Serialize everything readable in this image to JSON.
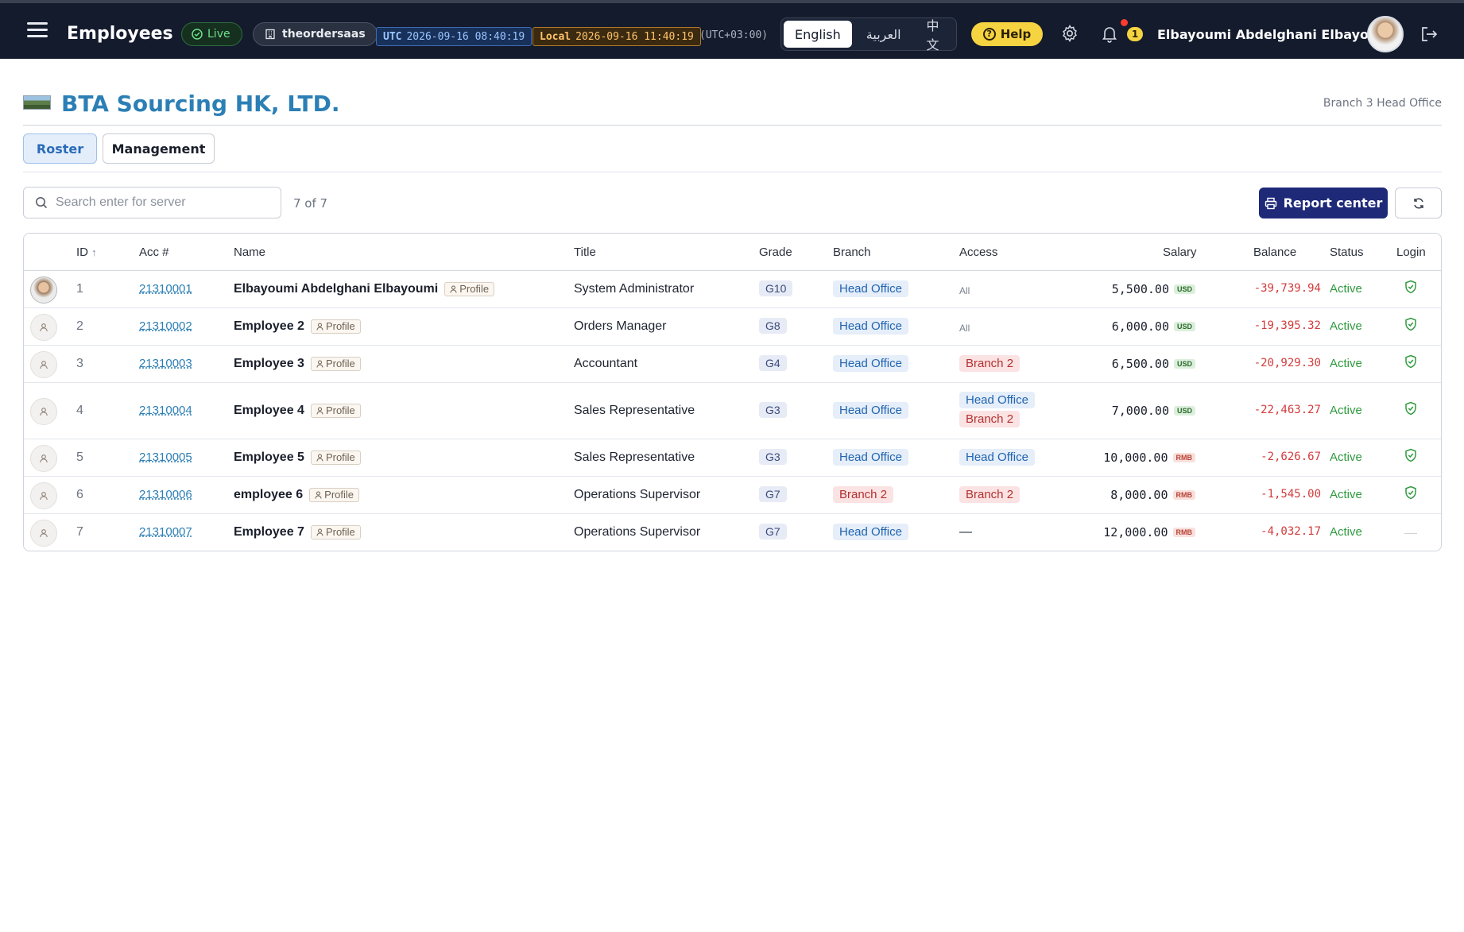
{
  "topbar": {
    "title": "Employees",
    "live": "Live",
    "tenant": "theordersaas",
    "utc_label": "UTC",
    "utc_time": "2026-09-16 08:40:19",
    "local_label": "Local",
    "local_time": "2026-09-16 11:40:19",
    "tz": "(UTC+03:00)",
    "languages": [
      "English",
      "العربية",
      "中文"
    ],
    "help": "Help",
    "notif_count": "1",
    "user": "Elbayoumi Abdelghani Elbayoumi"
  },
  "header": {
    "company": "BTA Sourcing HK, LTD.",
    "branch": "Branch 3 Head Office"
  },
  "tabs": [
    "Roster",
    "Management"
  ],
  "toolbar": {
    "search_placeholder": "Search enter for server",
    "count": "7 of 7",
    "report_label": "Report center"
  },
  "table": {
    "columns": [
      "ID",
      "Acc #",
      "Name",
      "Title",
      "Grade",
      "Branch",
      "Access",
      "Salary",
      "Balance",
      "Status",
      "Login"
    ],
    "profile_label": "Profile",
    "rows": [
      {
        "id": "1",
        "acc": "21310001",
        "name": "Elbayoumi Abdelghani Elbayoumi",
        "title": "System Administrator",
        "grade": "G10",
        "branch": "Head Office",
        "access": [
          "All"
        ],
        "salary": "5,500.00",
        "currency": "USD",
        "balance": "-39,739.94",
        "status": "Active",
        "login": true
      },
      {
        "id": "2",
        "acc": "21310002",
        "name": "Employee 2",
        "title": "Orders Manager",
        "grade": "G8",
        "branch": "Head Office",
        "access": [
          "All"
        ],
        "salary": "6,000.00",
        "currency": "USD",
        "balance": "-19,395.32",
        "status": "Active",
        "login": true
      },
      {
        "id": "3",
        "acc": "21310003",
        "name": "Employee 3",
        "title": "Accountant",
        "grade": "G4",
        "branch": "Head Office",
        "access": [
          "Branch 2"
        ],
        "salary": "6,500.00",
        "currency": "USD",
        "balance": "-20,929.30",
        "status": "Active",
        "login": true
      },
      {
        "id": "4",
        "acc": "21310004",
        "name": "Employee 4",
        "title": "Sales Representative",
        "grade": "G3",
        "branch": "Head Office",
        "access": [
          "Head Office",
          "Branch 2"
        ],
        "salary": "7,000.00",
        "currency": "USD",
        "balance": "-22,463.27",
        "status": "Active",
        "login": true
      },
      {
        "id": "5",
        "acc": "21310005",
        "name": "Employee 5",
        "title": "Sales Representative",
        "grade": "G3",
        "branch": "Head Office",
        "access": [
          "Head Office"
        ],
        "salary": "10,000.00",
        "currency": "RMB",
        "balance": "-2,626.67",
        "status": "Active",
        "login": true
      },
      {
        "id": "6",
        "acc": "21310006",
        "name": "employee 6",
        "title": "Operations Supervisor",
        "grade": "G7",
        "branch": "Branch 2",
        "access": [
          "Branch 2"
        ],
        "salary": "8,000.00",
        "currency": "RMB",
        "balance": "-1,545.00",
        "status": "Active",
        "login": true
      },
      {
        "id": "7",
        "acc": "21310007",
        "name": "Employee 7",
        "title": "Operations Supervisor",
        "grade": "G7",
        "branch": "Head Office",
        "access": [
          "—"
        ],
        "salary": "12,000.00",
        "currency": "RMB",
        "balance": "-4,032.17",
        "status": "Active",
        "login": false
      }
    ]
  },
  "colors": {
    "topbar": "#141b2d",
    "company": "#2c7fb5",
    "report_button": "#1e2a78",
    "active": "#2f9a3f",
    "negative": "#d23b3b"
  }
}
